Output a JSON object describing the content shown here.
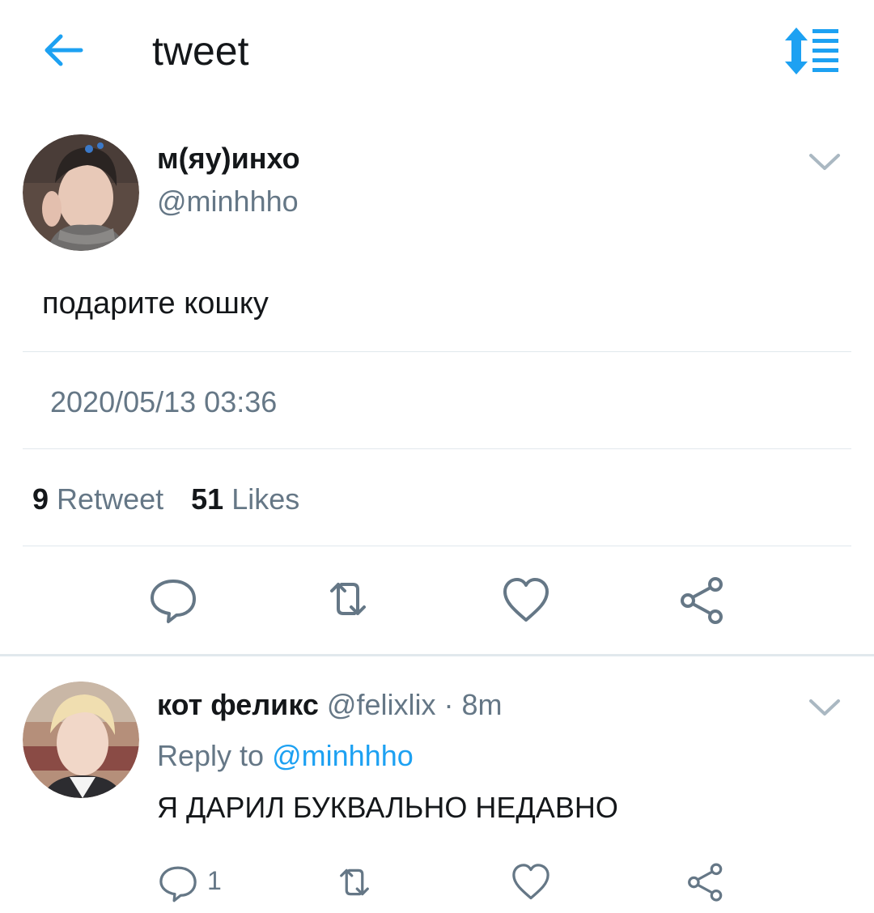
{
  "header": {
    "back_icon": "arrow-left-icon",
    "title": "tweet",
    "sort_icon": "sort-list-icon",
    "accent": "#1da1f2"
  },
  "tweet": {
    "avatar": "user-avatar-photo",
    "display_name": "м(яу)инхо",
    "handle": "@minhhho",
    "menu_icon": "chevron-down-icon",
    "text": "подарите кошку",
    "timestamp": "2020/05/13 03:36",
    "retweet_count": "9",
    "retweet_label": "Retweet",
    "likes_count": "51",
    "likes_label": "Likes",
    "actions": [
      "reply-icon",
      "retweet-icon",
      "heart-icon",
      "share-icon"
    ]
  },
  "reply": {
    "avatar": "user-avatar-photo",
    "display_name": "кот феликс",
    "handle": "@felixlix",
    "separator": "·",
    "time": "8m",
    "reply_to_label": "Reply to",
    "reply_to_handle": "@minhhho",
    "text": "Я ДАРИЛ БУКВАЛЬНО НЕДАВНО",
    "reply_count": "1",
    "menu_icon": "chevron-down-icon",
    "actions": [
      "reply-icon",
      "retweet-icon",
      "heart-icon",
      "share-icon"
    ]
  },
  "colors": {
    "text": "#14171a",
    "secondary": "#657786",
    "divider": "#e1e8ed",
    "accent": "#1da1f2"
  }
}
